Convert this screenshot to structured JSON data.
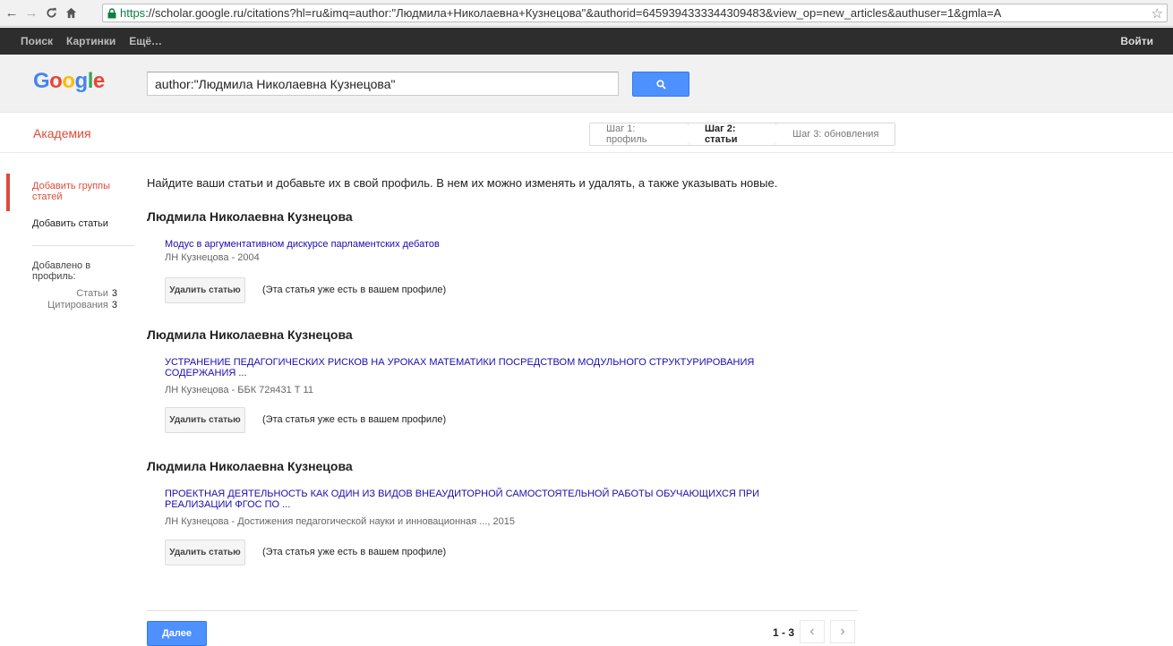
{
  "browser": {
    "url_scheme": "https",
    "url_rest": "://scholar.google.ru/citations?hl=ru&imq=author:\"Людмила+Николаевна+Кузнецова\"&authorid=6459394333344309483&view_op=new_articles&authuser=1&gmla=A"
  },
  "gbar": {
    "items": [
      "Поиск",
      "Картинки",
      "Ещё…"
    ],
    "signin": "Войти"
  },
  "search": {
    "value": "author:\"Людмила Николаевна Кузнецова\""
  },
  "brand": "Академия",
  "steps": [
    "Шаг 1: профиль",
    "Шаг 2: статьи",
    "Шаг 3: обновления"
  ],
  "sidebar": {
    "active_item": "Добавить группы статей",
    "item2": "Добавить статьи",
    "added_label": "Добавлено в профиль:",
    "stats": [
      {
        "label": "Статьи",
        "value": "3"
      },
      {
        "label": "Цитирования",
        "value": "3"
      }
    ]
  },
  "intro": "Найдите ваши статьи и добавьте их в свой профиль. В нем их можно изменять и удалять, а также указывать новые.",
  "groups": [
    {
      "author": "Людмила Николаевна Кузнецова",
      "title": "Модус в аргументативном дискурсе парламентских дебатов",
      "meta": "ЛН Кузнецова - 2004",
      "button": "Удалить статью",
      "note": "(Эта статья уже есть в вашем профиле)"
    },
    {
      "author": "Людмила Николаевна Кузнецова",
      "title": "УСТРАНЕНИЕ ПЕДАГОГИЧЕСКИХ РИСКОВ НА УРОКАХ МАТЕМАТИКИ ПОСРЕДСТВОМ МОДУЛЬНОГО СТРУКТУРИРОВАНИЯ СОДЕРЖАНИЯ ...",
      "meta": "ЛН Кузнецова - ББК 72я431 Т 11",
      "button": "Удалить статью",
      "note": "(Эта статья уже есть в вашем профиле)"
    },
    {
      "author": "Людмила Николаевна Кузнецова",
      "title": "ПРОЕКТНАЯ ДЕЯТЕЛЬНОСТЬ КАК ОДИН ИЗ ВИДОВ ВНЕАУДИТОРНОЙ САМОСТОЯТЕЛЬНОЙ РАБОТЫ ОБУЧАЮЩИХСЯ ПРИ РЕАЛИЗАЦИИ ФГОС ПО ...",
      "meta": "ЛН Кузнецова - Достижения педагогической науки и инновационная ..., 2015",
      "button": "Удалить статью",
      "note": "(Эта статья уже есть в вашем профиле)"
    }
  ],
  "footer": {
    "next": "Далее",
    "range": "1 - 3"
  }
}
